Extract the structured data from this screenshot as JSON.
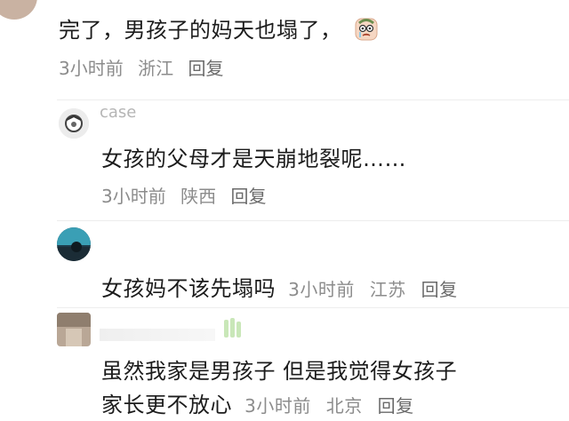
{
  "comments": [
    {
      "text": "完了，男孩子的妈天也塌了，",
      "time": "3小时前",
      "location": "浙江",
      "reply_label": "回复"
    },
    {
      "username": "case",
      "text": "女孩的父母才是天崩地裂呢……",
      "time": "3小时前",
      "location": "陕西",
      "reply_label": "回复"
    },
    {
      "text": "女孩妈不该先塌吗",
      "time": "3小时前",
      "location": "江苏",
      "reply_label": "回复"
    },
    {
      "text_line1": "虽然我家是男孩子 但是我觉得女孩子",
      "text_line2": "家长更不放心",
      "time": "3小时前",
      "location": "北京",
      "reply_label": "回复"
    }
  ],
  "icons": {
    "emoji_sticker": "crying-face-sticker-icon"
  }
}
